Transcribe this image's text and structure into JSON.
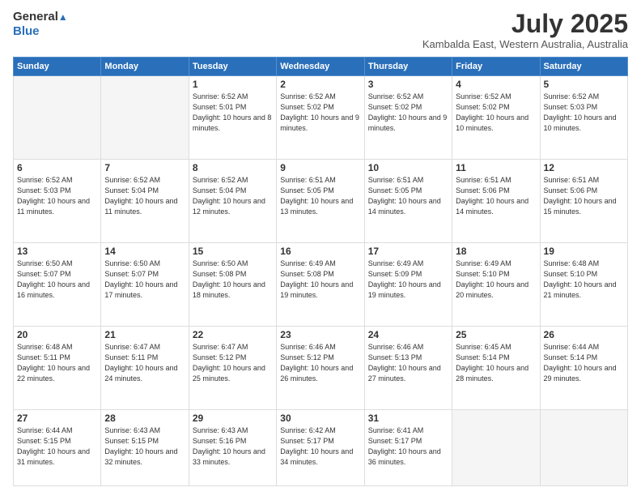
{
  "header": {
    "logo_line1": "General",
    "logo_line2": "Blue",
    "month_title": "July 2025",
    "location": "Kambalda East, Western Australia, Australia"
  },
  "weekdays": [
    "Sunday",
    "Monday",
    "Tuesday",
    "Wednesday",
    "Thursday",
    "Friday",
    "Saturday"
  ],
  "weeks": [
    [
      {
        "day": "",
        "empty": true
      },
      {
        "day": "",
        "empty": true
      },
      {
        "day": "1",
        "sunrise": "Sunrise: 6:52 AM",
        "sunset": "Sunset: 5:01 PM",
        "daylight": "Daylight: 10 hours and 8 minutes."
      },
      {
        "day": "2",
        "sunrise": "Sunrise: 6:52 AM",
        "sunset": "Sunset: 5:02 PM",
        "daylight": "Daylight: 10 hours and 9 minutes."
      },
      {
        "day": "3",
        "sunrise": "Sunrise: 6:52 AM",
        "sunset": "Sunset: 5:02 PM",
        "daylight": "Daylight: 10 hours and 9 minutes."
      },
      {
        "day": "4",
        "sunrise": "Sunrise: 6:52 AM",
        "sunset": "Sunset: 5:02 PM",
        "daylight": "Daylight: 10 hours and 10 minutes."
      },
      {
        "day": "5",
        "sunrise": "Sunrise: 6:52 AM",
        "sunset": "Sunset: 5:03 PM",
        "daylight": "Daylight: 10 hours and 10 minutes."
      }
    ],
    [
      {
        "day": "6",
        "sunrise": "Sunrise: 6:52 AM",
        "sunset": "Sunset: 5:03 PM",
        "daylight": "Daylight: 10 hours and 11 minutes."
      },
      {
        "day": "7",
        "sunrise": "Sunrise: 6:52 AM",
        "sunset": "Sunset: 5:04 PM",
        "daylight": "Daylight: 10 hours and 11 minutes."
      },
      {
        "day": "8",
        "sunrise": "Sunrise: 6:52 AM",
        "sunset": "Sunset: 5:04 PM",
        "daylight": "Daylight: 10 hours and 12 minutes."
      },
      {
        "day": "9",
        "sunrise": "Sunrise: 6:51 AM",
        "sunset": "Sunset: 5:05 PM",
        "daylight": "Daylight: 10 hours and 13 minutes."
      },
      {
        "day": "10",
        "sunrise": "Sunrise: 6:51 AM",
        "sunset": "Sunset: 5:05 PM",
        "daylight": "Daylight: 10 hours and 14 minutes."
      },
      {
        "day": "11",
        "sunrise": "Sunrise: 6:51 AM",
        "sunset": "Sunset: 5:06 PM",
        "daylight": "Daylight: 10 hours and 14 minutes."
      },
      {
        "day": "12",
        "sunrise": "Sunrise: 6:51 AM",
        "sunset": "Sunset: 5:06 PM",
        "daylight": "Daylight: 10 hours and 15 minutes."
      }
    ],
    [
      {
        "day": "13",
        "sunrise": "Sunrise: 6:50 AM",
        "sunset": "Sunset: 5:07 PM",
        "daylight": "Daylight: 10 hours and 16 minutes."
      },
      {
        "day": "14",
        "sunrise": "Sunrise: 6:50 AM",
        "sunset": "Sunset: 5:07 PM",
        "daylight": "Daylight: 10 hours and 17 minutes."
      },
      {
        "day": "15",
        "sunrise": "Sunrise: 6:50 AM",
        "sunset": "Sunset: 5:08 PM",
        "daylight": "Daylight: 10 hours and 18 minutes."
      },
      {
        "day": "16",
        "sunrise": "Sunrise: 6:49 AM",
        "sunset": "Sunset: 5:08 PM",
        "daylight": "Daylight: 10 hours and 19 minutes."
      },
      {
        "day": "17",
        "sunrise": "Sunrise: 6:49 AM",
        "sunset": "Sunset: 5:09 PM",
        "daylight": "Daylight: 10 hours and 19 minutes."
      },
      {
        "day": "18",
        "sunrise": "Sunrise: 6:49 AM",
        "sunset": "Sunset: 5:10 PM",
        "daylight": "Daylight: 10 hours and 20 minutes."
      },
      {
        "day": "19",
        "sunrise": "Sunrise: 6:48 AM",
        "sunset": "Sunset: 5:10 PM",
        "daylight": "Daylight: 10 hours and 21 minutes."
      }
    ],
    [
      {
        "day": "20",
        "sunrise": "Sunrise: 6:48 AM",
        "sunset": "Sunset: 5:11 PM",
        "daylight": "Daylight: 10 hours and 22 minutes."
      },
      {
        "day": "21",
        "sunrise": "Sunrise: 6:47 AM",
        "sunset": "Sunset: 5:11 PM",
        "daylight": "Daylight: 10 hours and 24 minutes."
      },
      {
        "day": "22",
        "sunrise": "Sunrise: 6:47 AM",
        "sunset": "Sunset: 5:12 PM",
        "daylight": "Daylight: 10 hours and 25 minutes."
      },
      {
        "day": "23",
        "sunrise": "Sunrise: 6:46 AM",
        "sunset": "Sunset: 5:12 PM",
        "daylight": "Daylight: 10 hours and 26 minutes."
      },
      {
        "day": "24",
        "sunrise": "Sunrise: 6:46 AM",
        "sunset": "Sunset: 5:13 PM",
        "daylight": "Daylight: 10 hours and 27 minutes."
      },
      {
        "day": "25",
        "sunrise": "Sunrise: 6:45 AM",
        "sunset": "Sunset: 5:14 PM",
        "daylight": "Daylight: 10 hours and 28 minutes."
      },
      {
        "day": "26",
        "sunrise": "Sunrise: 6:44 AM",
        "sunset": "Sunset: 5:14 PM",
        "daylight": "Daylight: 10 hours and 29 minutes."
      }
    ],
    [
      {
        "day": "27",
        "sunrise": "Sunrise: 6:44 AM",
        "sunset": "Sunset: 5:15 PM",
        "daylight": "Daylight: 10 hours and 31 minutes."
      },
      {
        "day": "28",
        "sunrise": "Sunrise: 6:43 AM",
        "sunset": "Sunset: 5:15 PM",
        "daylight": "Daylight: 10 hours and 32 minutes."
      },
      {
        "day": "29",
        "sunrise": "Sunrise: 6:43 AM",
        "sunset": "Sunset: 5:16 PM",
        "daylight": "Daylight: 10 hours and 33 minutes."
      },
      {
        "day": "30",
        "sunrise": "Sunrise: 6:42 AM",
        "sunset": "Sunset: 5:17 PM",
        "daylight": "Daylight: 10 hours and 34 minutes."
      },
      {
        "day": "31",
        "sunrise": "Sunrise: 6:41 AM",
        "sunset": "Sunset: 5:17 PM",
        "daylight": "Daylight: 10 hours and 36 minutes."
      },
      {
        "day": "",
        "empty": true
      },
      {
        "day": "",
        "empty": true
      }
    ]
  ]
}
